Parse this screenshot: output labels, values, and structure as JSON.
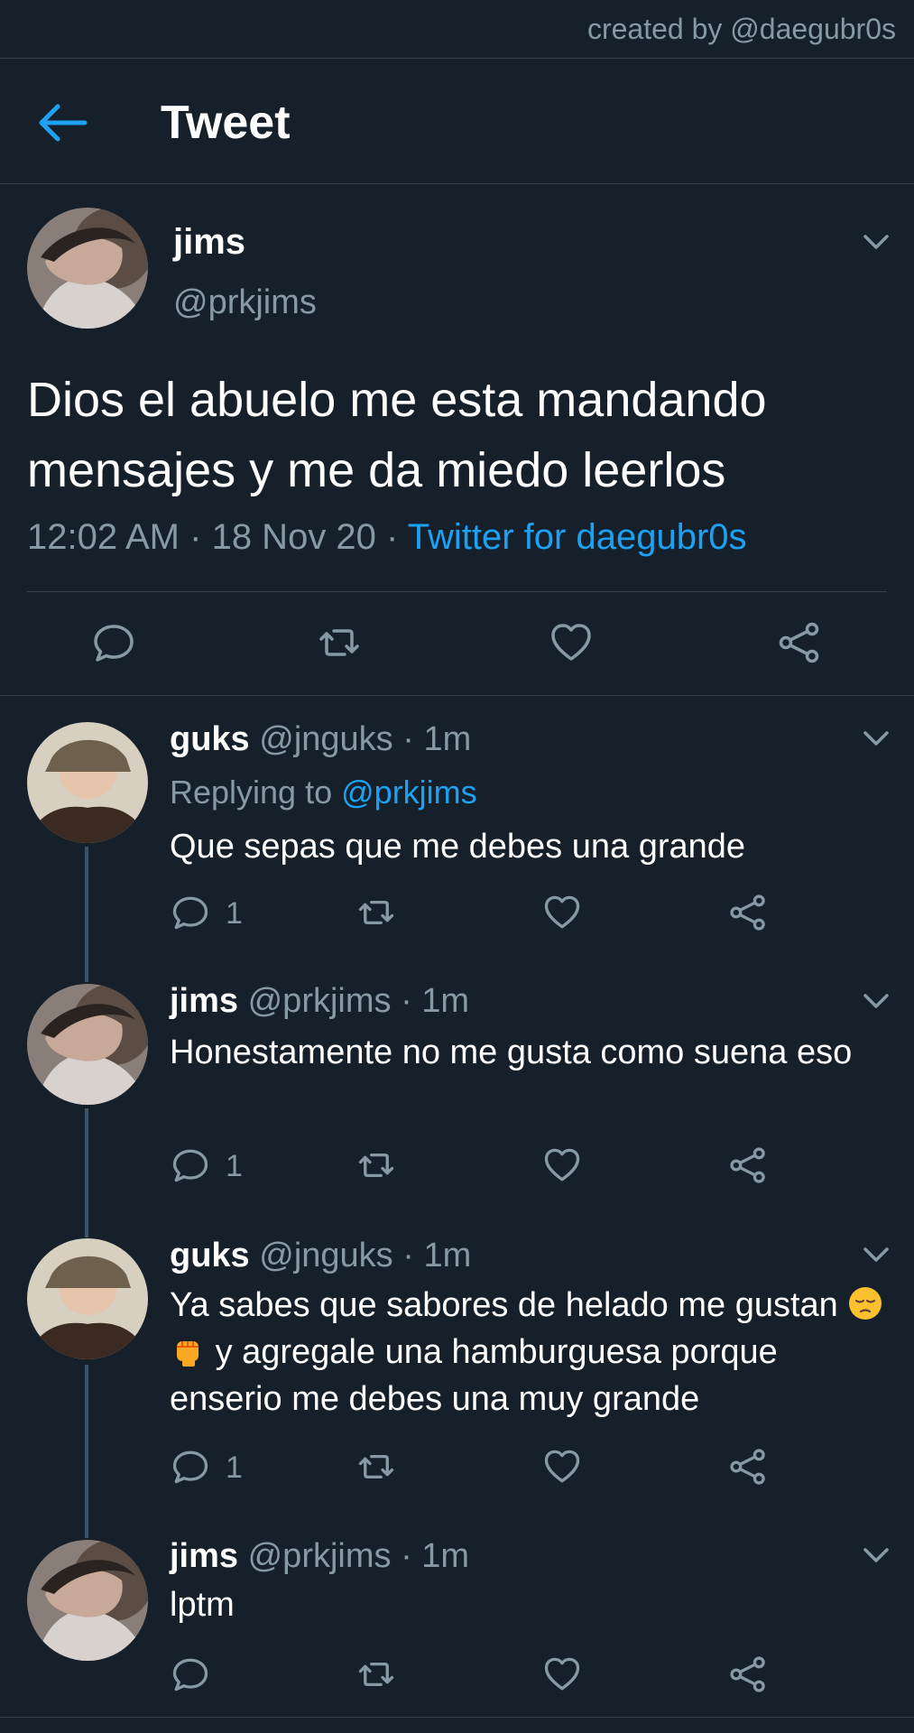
{
  "credit": "created by @daegubr0s",
  "header": {
    "title": "Tweet"
  },
  "main_tweet": {
    "name": "jims",
    "handle": "@prkjims",
    "text": "Dios el abuelo me esta mandando mensajes y me da miedo leerlos",
    "time": "12:02 AM",
    "date": "18 Nov 20",
    "source": "Twitter for daegubr0s"
  },
  "replies": [
    {
      "name": "guks",
      "handle": "@jnguks",
      "time": "1m",
      "replying_prefix": "Replying to",
      "replying_to": "@prkjims",
      "text": "Que sepas que me debes una grande",
      "reply_count": "1"
    },
    {
      "name": "jims",
      "handle": "@prkjims",
      "time": "1m",
      "text": "Honestamente no me gusta como suena eso",
      "reply_count": "1"
    },
    {
      "name": "guks",
      "handle": "@jnguks",
      "time": "1m",
      "text_before_emoji": "Ya sabes que sabores de helado me gustan",
      "text_after_emoji": "y agregale una hamburguesa porque enserio me debes una muy grande",
      "emojis": [
        "pensive-face",
        "raised-fist"
      ],
      "reply_count": "1"
    },
    {
      "name": "jims",
      "handle": "@prkjims",
      "time": "1m",
      "text": "lptm"
    }
  ],
  "icons": {
    "back": "arrow-left-icon",
    "reply": "reply-icon",
    "retweet": "retweet-icon",
    "like": "heart-icon",
    "share": "share-icon",
    "menu": "chevron-down-icon"
  },
  "colors": {
    "background": "#15202b",
    "accent": "#1da1f2",
    "muted": "#8899a6",
    "divider": "#38444d"
  }
}
